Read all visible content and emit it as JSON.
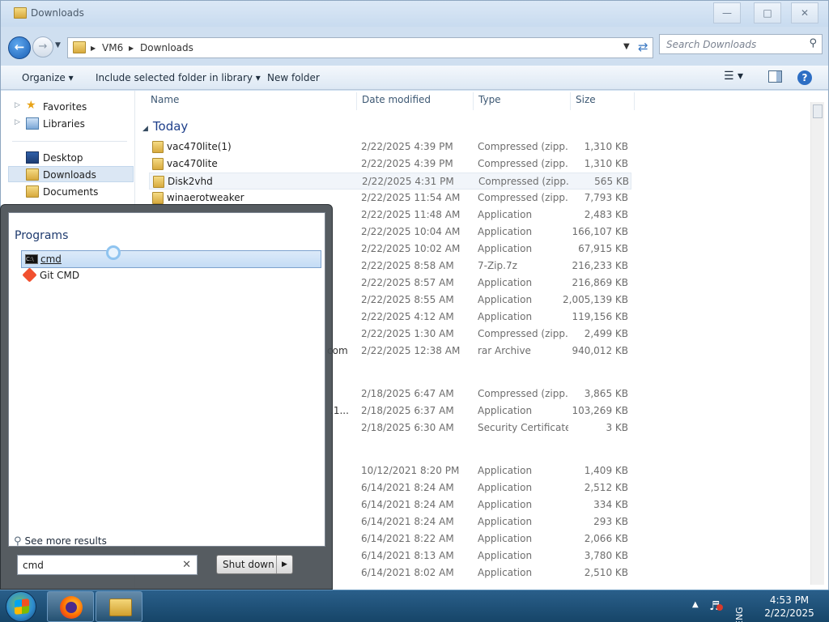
{
  "window": {
    "title": "Downloads",
    "buttons": {
      "minimize": "—",
      "maximize": "□",
      "close": "✕"
    }
  },
  "address_bar": {
    "crumbs": [
      "VM6",
      "Downloads"
    ],
    "search_placeholder": "Search Downloads"
  },
  "toolbar": {
    "organize": "Organize",
    "include": "Include selected folder in library",
    "new_folder": "New folder"
  },
  "nav_pane": {
    "items": [
      {
        "label": "Favorites",
        "icon": "star-icon"
      },
      {
        "label": "Libraries",
        "icon": "libraries-icon"
      },
      {
        "label": "Desktop",
        "icon": "desktop-icon"
      },
      {
        "label": "Downloads",
        "icon": "folder-icon",
        "selected": true
      },
      {
        "label": "Documents",
        "icon": "documents-icon"
      }
    ]
  },
  "file_list": {
    "columns": [
      "Name",
      "Date modified",
      "Type",
      "Size"
    ],
    "group": "Today",
    "rows": [
      {
        "name": "vac470lite(1)",
        "date": "2/22/2025 4:39 PM",
        "type": "Compressed (zipp...",
        "size": "1,310 KB"
      },
      {
        "name": "vac470lite",
        "date": "2/22/2025 4:39 PM",
        "type": "Compressed (zipp...",
        "size": "1,310 KB"
      },
      {
        "name": "Disk2vhd",
        "date": "2/22/2025 4:31 PM",
        "type": "Compressed (zipp...",
        "size": "565 KB"
      },
      {
        "name": "winaerotweaker",
        "date": "2/22/2025 11:54 AM",
        "type": "Compressed (zipp...",
        "size": "7,793 KB"
      },
      {
        "name": "",
        "date": "2/22/2025 11:48 AM",
        "type": "Application",
        "size": "2,483 KB"
      },
      {
        "name": "",
        "date": "2/22/2025 10:04 AM",
        "type": "Application",
        "size": "166,107 KB"
      },
      {
        "name": "",
        "date": "2/22/2025 10:02 AM",
        "type": "Application",
        "size": "67,915 KB"
      },
      {
        "name": "",
        "date": "2/22/2025 8:58 AM",
        "type": "7-Zip.7z",
        "size": "216,233 KB"
      },
      {
        "name": "",
        "date": "2/22/2025 8:57 AM",
        "type": "Application",
        "size": "216,869 KB"
      },
      {
        "name": "",
        "date": "2/22/2025 8:55 AM",
        "type": "Application",
        "size": "2,005,139 KB"
      },
      {
        "name": "",
        "date": "2/22/2025 4:12 AM",
        "type": "Application",
        "size": "119,156 KB"
      },
      {
        "name": "",
        "date": "2/22/2025 1:30 AM",
        "type": "Compressed (zipp...",
        "size": "2,499 KB"
      },
      {
        "name": "",
        "frag": "com",
        "date": "2/22/2025 12:38 AM",
        "type": "rar Archive",
        "size": "940,012 KB"
      },
      {
        "name": "",
        "date": "2/18/2025 6:47 AM",
        "type": "Compressed (zipp...",
        "size": "3,865 KB"
      },
      {
        "name": "",
        "frag": ".1...",
        "date": "2/18/2025 6:37 AM",
        "type": "Application",
        "size": "103,269 KB"
      },
      {
        "name": "",
        "date": "2/18/2025 6:30 AM",
        "type": "Security Certificate",
        "size": "3 KB"
      },
      {
        "name": "",
        "date": "10/12/2021 8:20 PM",
        "type": "Application",
        "size": "1,409 KB"
      },
      {
        "name": "",
        "date": "6/14/2021 8:24 AM",
        "type": "Application",
        "size": "2,512 KB"
      },
      {
        "name": "",
        "date": "6/14/2021 8:24 AM",
        "type": "Application",
        "size": "334 KB"
      },
      {
        "name": "",
        "date": "6/14/2021 8:24 AM",
        "type": "Application",
        "size": "293 KB"
      },
      {
        "name": "",
        "date": "6/14/2021 8:22 AM",
        "type": "Application",
        "size": "2,066 KB"
      },
      {
        "name": "",
        "date": "6/14/2021 8:13 AM",
        "type": "Application",
        "size": "3,780 KB"
      },
      {
        "name": "",
        "date": "6/14/2021 8:02 AM",
        "type": "Application",
        "size": "2,510 KB"
      }
    ]
  },
  "start_menu": {
    "section": "Programs",
    "programs": [
      {
        "label": "cmd",
        "icon": "cmd-icon",
        "selected": true
      },
      {
        "label": "Git CMD",
        "icon": "git-icon",
        "selected": false
      }
    ],
    "see_more": "See more results",
    "search_value": "cmd",
    "clear": "✕",
    "shutdown": "Shut down"
  },
  "taskbar": {
    "lang": "ENG",
    "time": "4:53 PM",
    "date": "2/22/2025"
  }
}
